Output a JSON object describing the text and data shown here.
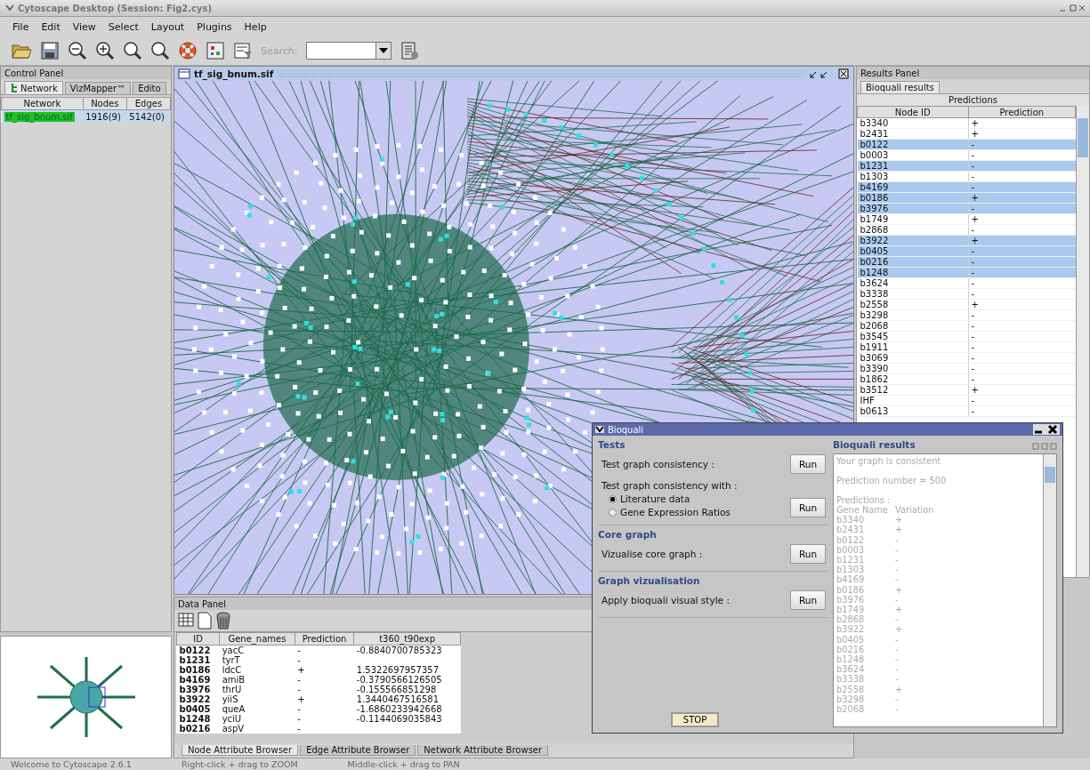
{
  "window": {
    "title": "Cytoscape Desktop (Session: Fig2.cys)"
  },
  "menu": [
    "File",
    "Edit",
    "View",
    "Select",
    "Layout",
    "Plugins",
    "Help"
  ],
  "toolbar": {
    "search_label": "Search:"
  },
  "control_panel": {
    "title": "Control Panel",
    "tabs": [
      {
        "label": "Network",
        "selected": true
      },
      {
        "label": "VizMapper™",
        "selected": false
      },
      {
        "label": "Edito",
        "selected": false
      }
    ],
    "columns": [
      "Network",
      "Nodes",
      "Edges"
    ],
    "rows": [
      {
        "network": "tf_sig_bnum.sif",
        "nodes": "1916(9)",
        "edges": "5142(0)",
        "selected": true
      }
    ]
  },
  "network_view": {
    "title": "tf_sig_bnum.sif"
  },
  "results_panel": {
    "title": "Results Panel",
    "tab": "Bioquali results",
    "caption": "Predictions",
    "columns": [
      "Node ID",
      "Prediction"
    ],
    "rows": [
      {
        "node_id": "b3340",
        "prediction": "+",
        "selected": false
      },
      {
        "node_id": "b2431",
        "prediction": "+",
        "selected": false
      },
      {
        "node_id": "b0122",
        "prediction": "-",
        "selected": true
      },
      {
        "node_id": "b0003",
        "prediction": "-",
        "selected": false
      },
      {
        "node_id": "b1231",
        "prediction": "-",
        "selected": true
      },
      {
        "node_id": "b1303",
        "prediction": "-",
        "selected": false
      },
      {
        "node_id": "b4169",
        "prediction": "-",
        "selected": true
      },
      {
        "node_id": "b0186",
        "prediction": "+",
        "selected": true
      },
      {
        "node_id": "b3976",
        "prediction": "-",
        "selected": true
      },
      {
        "node_id": "b1749",
        "prediction": "+",
        "selected": false
      },
      {
        "node_id": "b2868",
        "prediction": "-",
        "selected": false
      },
      {
        "node_id": "b3922",
        "prediction": "+",
        "selected": true
      },
      {
        "node_id": "b0405",
        "prediction": "-",
        "selected": true
      },
      {
        "node_id": "b0216",
        "prediction": "-",
        "selected": true
      },
      {
        "node_id": "b1248",
        "prediction": "-",
        "selected": true
      },
      {
        "node_id": "b3624",
        "prediction": "-",
        "selected": false
      },
      {
        "node_id": "b3338",
        "prediction": "-",
        "selected": false
      },
      {
        "node_id": "b2558",
        "prediction": "+",
        "selected": false
      },
      {
        "node_id": "b3298",
        "prediction": "-",
        "selected": false
      },
      {
        "node_id": "b2068",
        "prediction": "-",
        "selected": false
      },
      {
        "node_id": "b3545",
        "prediction": "-",
        "selected": false
      },
      {
        "node_id": "b1911",
        "prediction": "-",
        "selected": false
      },
      {
        "node_id": "b3069",
        "prediction": "-",
        "selected": false
      },
      {
        "node_id": "b3390",
        "prediction": "-",
        "selected": false
      },
      {
        "node_id": "b1862",
        "prediction": "-",
        "selected": false
      },
      {
        "node_id": "b3512",
        "prediction": "+",
        "selected": false
      },
      {
        "node_id": "IHF",
        "prediction": "-",
        "selected": false
      },
      {
        "node_id": "b0613",
        "prediction": "-",
        "selected": false
      }
    ]
  },
  "data_panel": {
    "title": "Data Panel",
    "columns": [
      "ID",
      "Gene_names",
      "Prediction",
      "t360_t90exp"
    ],
    "rows": [
      {
        "id": "b0122",
        "gene": "yacC",
        "prediction": "-",
        "value": "-0.8840700785323"
      },
      {
        "id": "b1231",
        "gene": "tyrT",
        "prediction": "-",
        "value": ""
      },
      {
        "id": "b0186",
        "gene": "ldcC",
        "prediction": "+",
        "value": "1.5322697957357"
      },
      {
        "id": "b4169",
        "gene": "amiB",
        "prediction": "-",
        "value": "-0.3790566126505"
      },
      {
        "id": "b3976",
        "gene": "thrU",
        "prediction": "-",
        "value": "-0.155566851298"
      },
      {
        "id": "b3922",
        "gene": "yiiS",
        "prediction": "+",
        "value": "1.3440467516581"
      },
      {
        "id": "b0405",
        "gene": "queA",
        "prediction": "-",
        "value": "-1.6860233942668"
      },
      {
        "id": "b1248",
        "gene": "yciU",
        "prediction": "-",
        "value": "-0.1144069035843"
      },
      {
        "id": "b0216",
        "gene": "aspV",
        "prediction": "-",
        "value": ""
      }
    ],
    "tabs": [
      {
        "label": "Node Attribute Browser",
        "selected": true
      },
      {
        "label": "Edge Attribute Browser",
        "selected": false
      },
      {
        "label": "Network Attribute Browser",
        "selected": false
      }
    ]
  },
  "status_bar": [
    "Welcome to Cytoscape 2.6.1",
    "Right-click + drag to ZOOM",
    "Middle-click + drag to PAN"
  ],
  "dialog": {
    "title": "Bioquali",
    "sections": [
      {
        "title": "Tests",
        "items": [
          {
            "kind": "action",
            "label": "Test graph consistency :",
            "button": "Run"
          },
          {
            "kind": "radio_action",
            "label": "Test graph consistency with :",
            "button": "Run",
            "options": [
              {
                "label": "Literature data",
                "selected": true
              },
              {
                "label": "Gene Expression Ratios",
                "selected": false
              }
            ]
          }
        ]
      },
      {
        "title": "Core graph",
        "items": [
          {
            "kind": "action",
            "label": "Vizualise core graph :",
            "button": "Run"
          }
        ]
      },
      {
        "title": "Graph vizualisation",
        "items": [
          {
            "kind": "action",
            "label": "Apply bioquali visual style :",
            "button": "Run"
          }
        ]
      }
    ],
    "stop_button": "STOP",
    "results_title": "Bioquali results",
    "results_lines": [
      "Your graph is consistent",
      "Prediction number = 500",
      "Predictions :"
    ],
    "results_header": [
      "Gene Name",
      "Variation"
    ],
    "results_rows": [
      [
        "b3340",
        "+"
      ],
      [
        "b2431",
        "+"
      ],
      [
        "b0122",
        "-"
      ],
      [
        "b0003",
        "-"
      ],
      [
        "b1231",
        "-"
      ],
      [
        "b1303",
        "-"
      ],
      [
        "b4169",
        "-"
      ],
      [
        "b0186",
        "+"
      ],
      [
        "b3976",
        "-"
      ],
      [
        "b1749",
        "+"
      ],
      [
        "b2868",
        "-"
      ],
      [
        "b3922",
        "+"
      ],
      [
        "b0405",
        "-"
      ],
      [
        "b0216",
        "-"
      ],
      [
        "b1248",
        "-"
      ],
      [
        "b3624",
        "-"
      ],
      [
        "b3338",
        "-"
      ],
      [
        "b2558",
        "+"
      ],
      [
        "b3298",
        "-"
      ],
      [
        "b2068",
        "-"
      ]
    ]
  }
}
